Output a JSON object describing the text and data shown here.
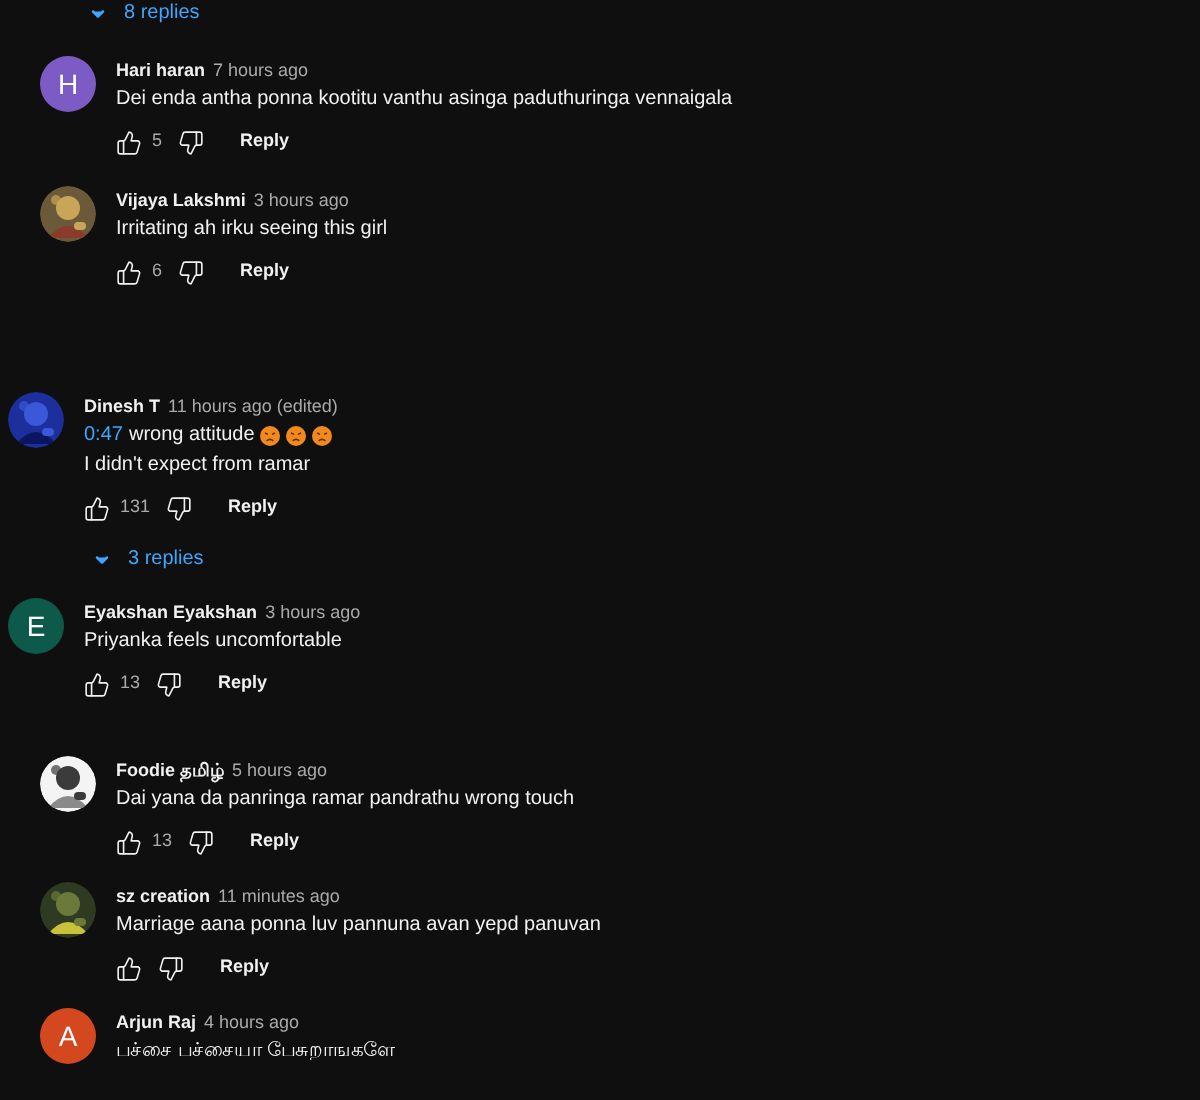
{
  "top_replies_toggle": {
    "label": "8 replies"
  },
  "comments": [
    {
      "author": "Hari haran",
      "time": "7 hours ago",
      "avatar": {
        "kind": "letter",
        "letter": "H",
        "color": "#7c5cc4"
      },
      "lines": [
        {
          "text": "Dei enda antha ponna kootitu vanthu asinga paduthuringa vennaigala"
        }
      ],
      "likes": "5",
      "reply": "Reply"
    },
    {
      "author": "Vijaya Lakshmi",
      "time": "3 hours ago",
      "avatar": {
        "kind": "picture"
      },
      "lines": [
        {
          "text": "Irritating ah irku seeing this girl"
        }
      ],
      "likes": "6",
      "reply": "Reply"
    },
    {
      "author": "Dinesh T",
      "time": "11 hours ago (edited)",
      "avatar": {
        "kind": "picture"
      },
      "lines": [
        {
          "timestamp": "0:47",
          "text": "wrong attitude",
          "reactions": [
            {
              "kind": "angry"
            },
            {
              "kind": "angry"
            },
            {
              "kind": "angry"
            }
          ]
        },
        {
          "text": "I didn't expect from ramar"
        }
      ],
      "likes": "131",
      "reply": "Reply",
      "replies_toggle": {
        "label": "3 replies"
      }
    },
    {
      "author": "Eyakshan Eyakshan",
      "time": "3 hours ago",
      "avatar": {
        "kind": "letter",
        "letter": "E",
        "color": "#0d5a4a"
      },
      "lines": [
        {
          "text": "Priyanka feels uncomfortable"
        }
      ],
      "likes": "13",
      "reply": "Reply"
    },
    {
      "author": "Foodie தமிழ்",
      "time": "5 hours ago",
      "avatar": {
        "kind": "picture"
      },
      "lines": [
        {
          "text": "Dai yana da panringa ramar pandrathu wrong touch"
        }
      ],
      "likes": "13",
      "reply": "Reply"
    },
    {
      "author": "sz creation",
      "time": "11 minutes ago",
      "avatar": {
        "kind": "picture"
      },
      "lines": [
        {
          "text": "Marriage aana ponna luv pannuna avan  yepd panuvan"
        }
      ],
      "reply": "Reply"
    },
    {
      "author": "Arjun Raj",
      "time": "4 hours ago",
      "avatar": {
        "kind": "letter",
        "letter": "A",
        "color": "#d4481f"
      },
      "lines": [
        {
          "text": "பச்சை பச்சையா பேசுறாஙகளே"
        }
      ]
    }
  ]
}
